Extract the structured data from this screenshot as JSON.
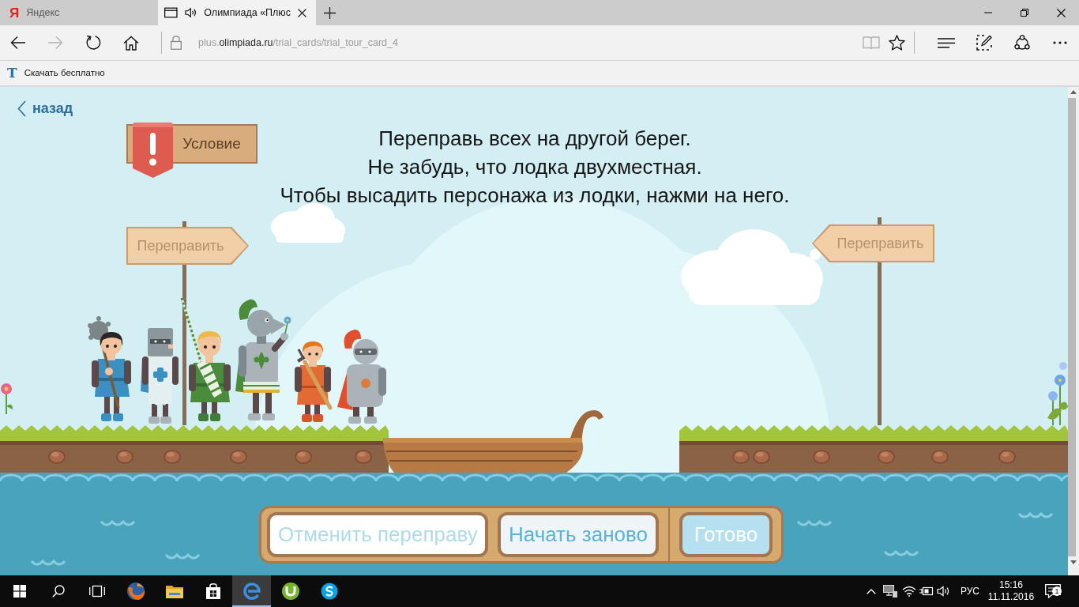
{
  "browser": {
    "tabs": [
      {
        "title": "Яндекс",
        "logo": "Я",
        "selected": false,
        "audio": false
      },
      {
        "title": "Олимпиада «Плюс",
        "selected": true,
        "audio": true
      }
    ],
    "nav_buttons": [
      {
        "kind": "back",
        "disabled": false
      },
      {
        "kind": "forward",
        "disabled": true
      },
      {
        "kind": "refresh",
        "disabled": false
      },
      {
        "kind": "home",
        "disabled": false
      }
    ],
    "address": {
      "secure": true,
      "subdomain": "plus.",
      "domain": "olimpiada.ru",
      "path": "/trial_cards/trial_tour_card_4"
    },
    "toolbar_buttons": [
      {
        "kind": "reading-view",
        "disabled": true
      },
      {
        "kind": "favorite",
        "disabled": false
      },
      {
        "kind": "hub",
        "disabled": false
      },
      {
        "kind": "note",
        "disabled": false
      },
      {
        "kind": "share",
        "disabled": false
      },
      {
        "kind": "more",
        "disabled": false
      }
    ],
    "favorites": [
      {
        "logo": "T",
        "label": "Скачать бесплатно"
      }
    ]
  },
  "page": {
    "back_link": "назад",
    "condition_sign": "Условие",
    "instructions": [
      "Переправь всех на другой берег.",
      "Не забудь, что лодка двухместная.",
      "Чтобы высадить персонажа из лодки, нажми на него."
    ],
    "left_sign": {
      "label": "Переправить",
      "disabled": true
    },
    "right_sign": {
      "label": "Переправить",
      "disabled": true
    },
    "left_bank": {
      "characters": [
        {
          "kind": "mace-peasant"
        },
        {
          "kind": "cross-knight"
        },
        {
          "kind": "lance-boy"
        },
        {
          "kind": "flower-knight"
        },
        {
          "kind": "sword-boy"
        },
        {
          "kind": "plume-knight"
        }
      ]
    },
    "buttons": [
      {
        "label": "Отменить переправу",
        "kind": "secondary",
        "disabled": true
      },
      {
        "label": "Начать заново",
        "kind": "secondary",
        "disabled": false
      },
      {
        "label": "Готово",
        "kind": "primary",
        "disabled": true
      }
    ]
  },
  "taskbar": {
    "buttons": [
      {
        "kind": "start",
        "selected": false
      },
      {
        "kind": "search",
        "selected": false
      },
      {
        "kind": "task-view",
        "selected": false
      },
      {
        "kind": "fox-browser",
        "selected": false
      },
      {
        "kind": "folder",
        "selected": false
      },
      {
        "kind": "store",
        "selected": false
      },
      {
        "kind": "e-browser",
        "selected": true
      },
      {
        "kind": "torrent",
        "selected": false
      },
      {
        "kind": "chat",
        "selected": false
      }
    ],
    "tray": {
      "language": "РУС",
      "time": "15:16",
      "date": "11.11.2016",
      "notifications": "1"
    }
  }
}
